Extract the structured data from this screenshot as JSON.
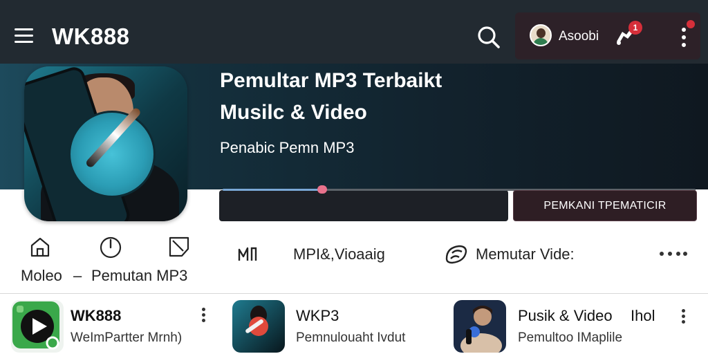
{
  "header": {
    "app_title": "WK888",
    "account_name": "Asoobi",
    "notification_count": "1",
    "icons": [
      "menu-icon",
      "search-icon",
      "avatar",
      "notification-icon",
      "more-vertical-icon"
    ],
    "colors": {
      "bar": "#222a31",
      "account_pane": "#2d2128",
      "badge": "#d62f3a"
    }
  },
  "hero": {
    "title_line1": "Pemultar MP3 Terbaikt",
    "title_line2": "Musilc & Video",
    "subtitle": "Penabic Pemn MP3",
    "progress": 0.21,
    "action_label": "PEMKANI TPEMATICIR",
    "colors": {
      "progress_fill": "#7aa8d6",
      "progress_thumb": "#e8728c",
      "button": "#2e1e24"
    }
  },
  "nav": {
    "items": [
      {
        "label": "Moleo",
        "icon": "home-icon"
      },
      {
        "label": "Pemutan MP3",
        "icon": "clock-icon"
      },
      {
        "label": "",
        "icon": "picture-icon"
      }
    ],
    "separator": "–"
  },
  "toolbar": {
    "tool_label": "MPI&,Vioaaig",
    "tool_icon": "equalizer-icon",
    "video_label": "Memutar Vide:",
    "video_icon": "video-play-icon"
  },
  "list": {
    "items": [
      {
        "title": "WK888",
        "subtitle": "WeImPartter Mrnh)",
        "extra": "",
        "thumb": "green-play-app-icon"
      },
      {
        "title": "WKP3",
        "subtitle": "Pemnulouaht Ivdut",
        "extra": "",
        "thumb": "singer-red-mic-thumbnail"
      },
      {
        "title": "Pusik & Video",
        "subtitle": "Pemultoo IMaplile",
        "extra": "Ihol",
        "thumb": "singer-blue-light-thumbnail"
      }
    ]
  }
}
